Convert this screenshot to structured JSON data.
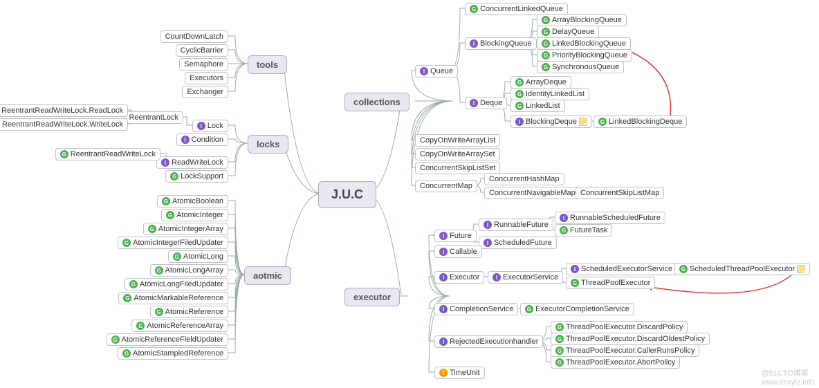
{
  "root": "J.U.C",
  "branches": {
    "tools": "tools",
    "locks": "locks",
    "atomic": "aotmic",
    "collections": "collections",
    "executor": "executor"
  },
  "tools": {
    "CountDownLatch": "CountDownLatch",
    "CyclicBarrier": "CyclicBarrier",
    "Semaphore": "Semaphore",
    "Executors": "Executors",
    "Exchanger": "Exchanger"
  },
  "locks": {
    "Lock": "Lock",
    "ReentrantLock": "ReentrantLock",
    "ReadLock": "ReentrantReadWriteLock.ReadLock",
    "WriteLock": "ReentrantReadWriteLock.WriteLock",
    "Condition": "Condition",
    "ReadWriteLock": "ReadWriteLock",
    "ReentrantReadWriteLock": "ReentrantReadWriteLock",
    "LockSupport": "LockSupport"
  },
  "atomic": {
    "AtomicBoolean": "AtomicBoolean",
    "AtomicInteger": "AtomicInteger",
    "AtomicIntegerArray": "AtomicIntegerArray",
    "AtomicIntegerFiledUpdater": "AtomicIntegerFiledUpdater",
    "AtomicLong": "AtomicLong",
    "AtomicLongArray": "AtomicLongArray",
    "AtomicLongFiledUpdater": "AtomicLongFiledUpdater",
    "AtomicMarkableReference": "AtomicMarkableReference",
    "AtomicReference": "AtomicReference",
    "AtomicReferenceArray": "AtomicReferenceArray",
    "AtomicReferenceFieldUpdater": "AtomicReferenceFieldUpdater",
    "AtomicStampledReference": "AtomicStampledReference"
  },
  "collections": {
    "Queue": "Queue",
    "ConcurrentLinkedQueue": "ConcurrentLinkedQueue",
    "BlockingQueue": "BlockingQueue",
    "ArrayBlockingQueue": "ArrayBlockingQueue",
    "DelayQueue": "DelayQueue",
    "LinkedBlockingQueue": "LinkedBlockingQueue",
    "PriorityBlockingQueue": "PriorityBlockingQueue",
    "SynchronousQueue": "SynchronousQueue",
    "Deque": "Deque",
    "ArrayDeque": "ArrayDeque",
    "IdentityLinkedList": "IdentityLinkedList",
    "LinkedList": "LinkedList",
    "BlockingDeque": "BlockingDeque",
    "LinkedBlockingDeque": "LinkedBlockingDeque",
    "CopyOnWriteArrayList": "CopyOnWriteArrayList",
    "CopyOnWriteArraySet": "CopyOnWriteArraySet",
    "ConcurrentSkipListSet": "ConcurrentSkipListSet",
    "ConcurrentMap": "ConcurrentMap",
    "ConcurrentHashMap": "ConcurrentHashMap",
    "ConcurrentNavigableMap": "ConcurrentNavigableMap",
    "ConcurrentSkipListMap": "ConcurrentSkipListMap"
  },
  "executor": {
    "Future": "Future",
    "RunnableFuture": "RunnableFuture",
    "RunnableScheduledFuture": "RunnableScheduledFuture",
    "FutureTask": "FutureTask",
    "ScheduledFuture": "ScheduledFuture",
    "Callable": "Callable",
    "Executor": "Executor",
    "ExecutorService": "ExecutorService",
    "ScheduledExecutorService": "ScheduledExecutorService",
    "ScheduledThreadPoolExecutor": "ScheduledThreadPoolExecutor",
    "ThreadPoolExecutor": "ThreadPoolExecutor",
    "CompletionService": "CompletionService",
    "ExecutorCompletionService": "ExecutorCompletionService",
    "RejectedExecutionhandler": "RejectedExecutionhandler",
    "DiscardPolicy": "ThreadPoolExecutor.DiscardPolicy",
    "DiscardOldestPolicy": "ThreadPoolExecutor.DiscardOldestPolicy",
    "CallerRunsPolicy": "ThreadPoolExecutor.CallerRunsPolicy",
    "AbortPolicy": "ThreadPoolExecutor.AbortPolicy",
    "TimeUnit": "TimeUnit"
  },
  "watermark1": "@51CTO博客",
  "watermark2": "www.imxylz.info"
}
